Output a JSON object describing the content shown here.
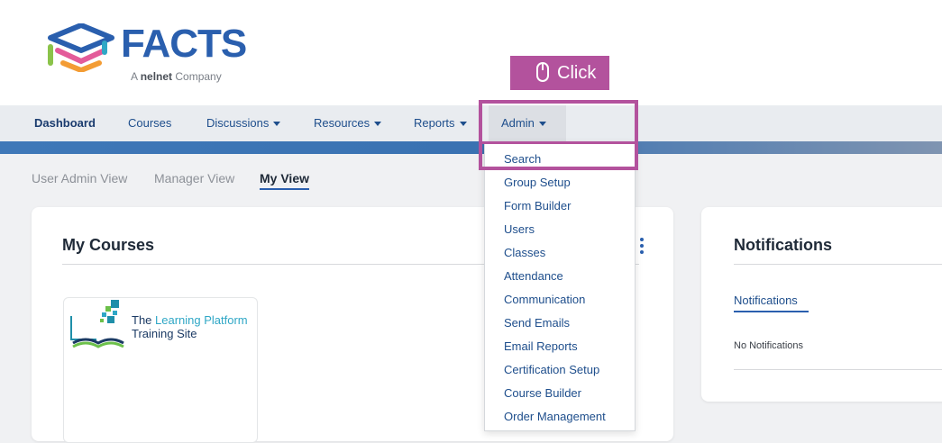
{
  "logo": {
    "brand": "FACTS",
    "tagline_prefix": "A",
    "tagline_brand": "nelnet",
    "tagline_suffix": "Company"
  },
  "tooltip": {
    "label": "Click"
  },
  "nav": {
    "items": [
      {
        "label": "Dashboard"
      },
      {
        "label": "Courses"
      },
      {
        "label": "Discussions"
      },
      {
        "label": "Resources"
      },
      {
        "label": "Reports"
      },
      {
        "label": "Admin"
      }
    ]
  },
  "views": {
    "items": [
      "User Admin View",
      "Manager View",
      "My View"
    ],
    "active": "My View"
  },
  "courses_card": {
    "title": "My Courses",
    "course": {
      "name_line1_prefix": "The",
      "name_line1_highlight": "Learning Platform",
      "name_line2": "Training Site"
    }
  },
  "notifications_card": {
    "title": "Notifications",
    "tab": "Notifications",
    "empty_text": "No Notifications"
  },
  "admin_menu": {
    "items": [
      "Search",
      "Group Setup",
      "Form Builder",
      "Users",
      "Classes",
      "Attendance",
      "Communication",
      "Send Emails",
      "Email Reports",
      "Certification Setup",
      "Course Builder",
      "Order Management"
    ]
  },
  "colors": {
    "brand_blue": "#2a5fae",
    "highlight": "#b3529d",
    "link": "#1e4e8c"
  }
}
